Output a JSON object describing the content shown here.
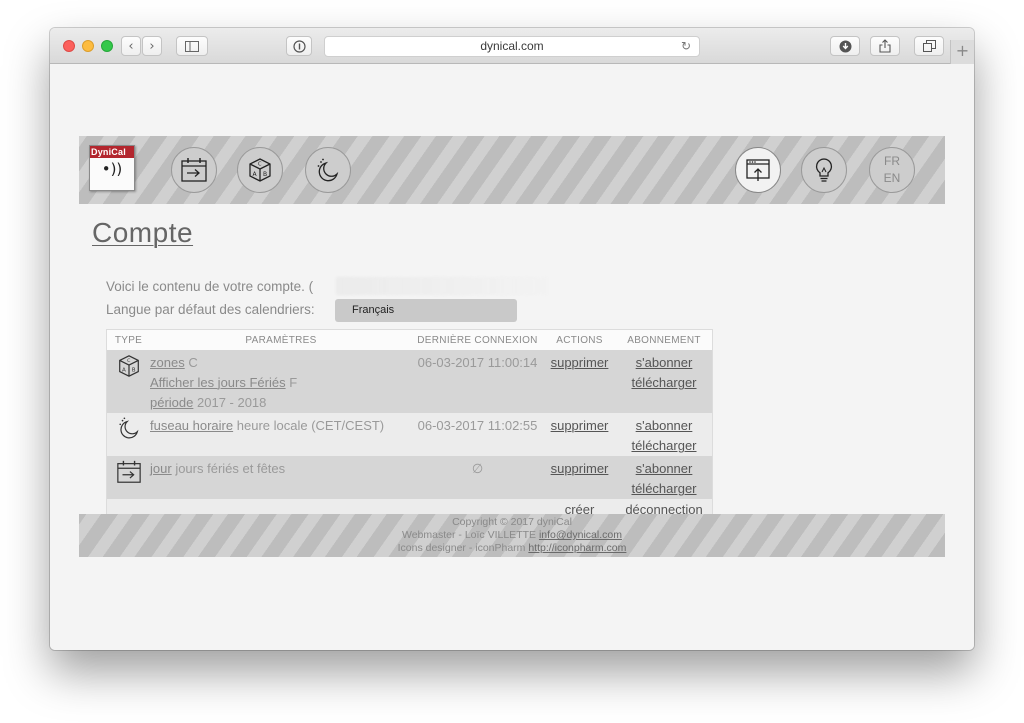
{
  "browser": {
    "url": "dynical.com",
    "back_glyph": "‹",
    "forward_glyph": "›",
    "newtab_glyph": "+"
  },
  "header": {
    "logo_text": "DyniCal",
    "logo_wave": "•))",
    "lang_fr": "FR",
    "lang_en": "EN"
  },
  "page": {
    "title": "Compte",
    "account_intro": "Voici le contenu de votre compte. (",
    "default_lang_label": "Langue par défaut des calendriers:",
    "default_lang_value": "Français"
  },
  "table": {
    "headers": {
      "type": "TYPE",
      "params": "PARAMÈTRES",
      "last_login": "DERNIÈRE CONNEXION",
      "actions": "ACTIONS",
      "subscription": "ABONNEMENT"
    },
    "rows": [
      {
        "icon": "dice-icon",
        "params": [
          {
            "key": "zones",
            "value": "C"
          },
          {
            "key": "Afficher les jours Fériés",
            "value": "F"
          },
          {
            "key": "période",
            "value": "2017 - 2018"
          }
        ],
        "last_login": "06-03-2017 11:00:14",
        "action": "supprimer",
        "subscribe": "s'abonner",
        "download": "télécharger"
      },
      {
        "icon": "moon-icon",
        "params": [
          {
            "key": "fuseau horaire",
            "value": "heure locale (CET/CEST)"
          }
        ],
        "last_login": "06-03-2017 11:02:55",
        "action": "supprimer",
        "subscribe": "s'abonner",
        "download": "télécharger"
      },
      {
        "icon": "calendar-arrow-icon",
        "params": [
          {
            "key": "jour",
            "value": "jours fériés et fêtes"
          }
        ],
        "last_login": "∅",
        "action": "supprimer",
        "subscribe": "s'abonner",
        "download": "télécharger"
      }
    ],
    "create": "créer",
    "logout": "déconnection"
  },
  "footer": {
    "copyright": "Copyright © 2017 dyniCal",
    "webmaster_prefix": "Webmaster - Loïc VILLETTE",
    "webmaster_email": "info@dynical.com",
    "icons_prefix": "Icons designer - iconPharm",
    "icons_url": "http://iconpharm.com"
  }
}
